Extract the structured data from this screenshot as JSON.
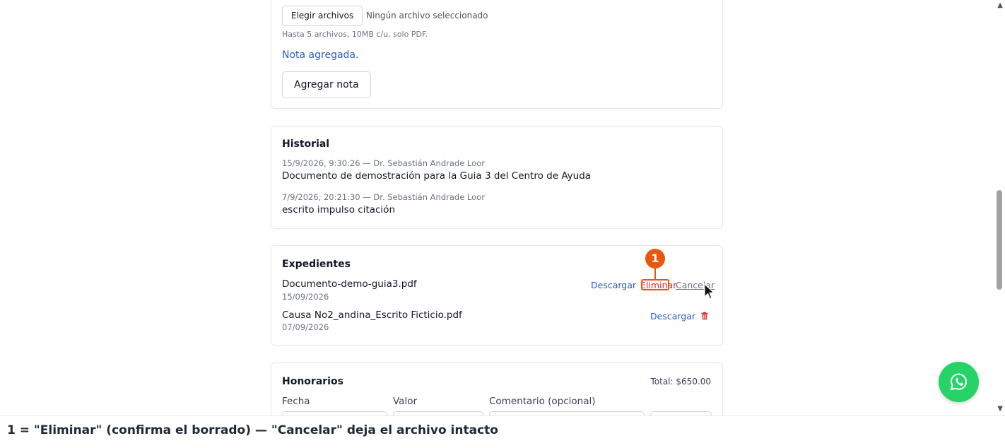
{
  "upload": {
    "choose_files_label": "Elegir archivos",
    "no_file_text": "Ningún archivo seleccionado",
    "hint": "Hasta 5 archivos, 10MB c/u, solo PDF.",
    "note_added": "Nota agregada.",
    "add_note_label": "Agregar nota"
  },
  "history": {
    "title": "Historial",
    "entries": [
      {
        "meta": "15/9/2026, 9:30:26 — Dr. Sebastián Andrade Loor",
        "text": "Documento de demostración para la Guia 3 del Centro de Ayuda"
      },
      {
        "meta": "7/9/2026, 20:21:30 — Dr. Sebastián Andrade Loor",
        "text": "escrito impulso citación"
      }
    ]
  },
  "files": {
    "title": "Expedientes",
    "items": [
      {
        "name": "Documento-demo-guia3.pdf",
        "date": "15/09/2026",
        "download": "Descargar",
        "delete": "Eliminar",
        "cancel": "Cancelar"
      },
      {
        "name": "Causa No2_andina_Escrito Ficticio.pdf",
        "date": "07/09/2026",
        "download": "Descargar"
      }
    ]
  },
  "fees": {
    "title": "Honorarios",
    "total": "Total: $650.00",
    "columns": [
      "Fecha",
      "Valor",
      "Comentario (opcional)"
    ]
  },
  "annotation": {
    "badge": "1",
    "caption": "1 = \"Eliminar\" (confirma el borrado) — \"Cancelar\" deja el archivo intacto"
  },
  "colors": {
    "link": "#2b59c3",
    "danger": "#dc2626",
    "annotation": "#e8580c",
    "whatsapp": "#25d366"
  },
  "icons": {
    "delete": "trash-icon",
    "chat": "whatsapp-icon",
    "pointer": "mouse-pointer-icon"
  }
}
